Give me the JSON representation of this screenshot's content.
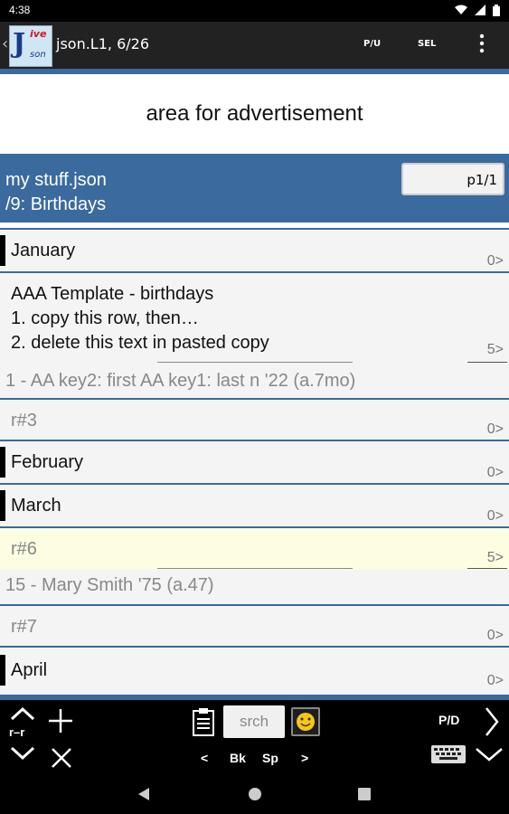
{
  "status_bar": {
    "time": "4:38"
  },
  "app_bar": {
    "back_glyph": "‹",
    "logo": {
      "letter": "J",
      "live": "ive",
      "json": "son"
    },
    "title": "json.L1, 6/26",
    "pu_label": "P/U",
    "sel_label": "SEL"
  },
  "ad": {
    "text": "area for advertisement"
  },
  "file_header": {
    "file_name": "my stuff.json",
    "path": "/9: Birthdays",
    "page": "p1/1"
  },
  "rows": [
    {
      "label": "January",
      "count": "0>",
      "section": true
    },
    {
      "lines": [
        "AAA Template - birthdays",
        "1. copy this row, then…",
        "2. delete this text in pasted copy"
      ],
      "count": "5>",
      "detail": "1 - AA key2: first  AA key1: last n '22 (a.7mo)"
    },
    {
      "label": "r#3",
      "count": "0>"
    },
    {
      "label": "February",
      "count": "0>",
      "section": true
    },
    {
      "label": "March",
      "count": "0>",
      "section": true
    },
    {
      "label": "r#6",
      "count": "5>",
      "detail": "15 - Mary Smith '75 (a.47)",
      "highlight": "#fdfde2"
    },
    {
      "label": "r#7",
      "count": "0>"
    },
    {
      "label": "April",
      "count": "0>",
      "section": true
    }
  ],
  "bottom_bar": {
    "search_placeholder": "srch",
    "left_label": "<",
    "bk_label": "Bk",
    "sp_label": "Sp",
    "right_label": ">",
    "pd_label": "P/D",
    "rr_label": "r–r"
  },
  "colors": {
    "accent": "#3a6a9e",
    "highlight": "#fdfde2",
    "row_bg": "#f4f4f4"
  }
}
